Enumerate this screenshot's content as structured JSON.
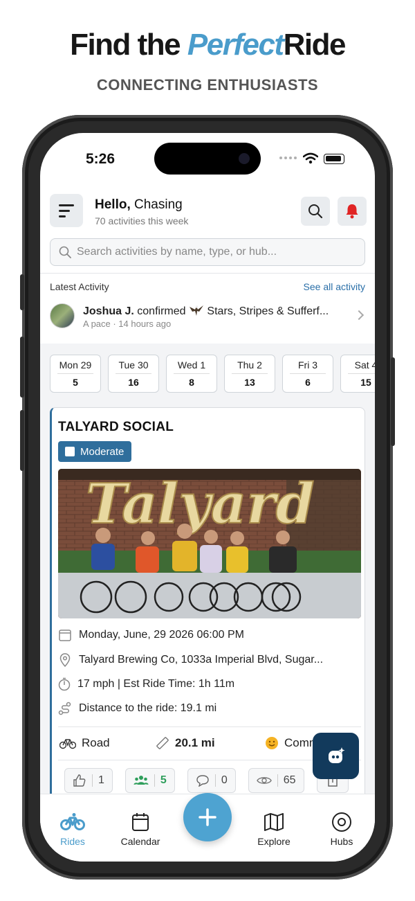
{
  "marketing": {
    "headline_pre": "Find the",
    "headline_accent": "Perfect",
    "headline_post": "Ride",
    "subheadline": "CONNECTING ENTHUSIASTS"
  },
  "status_bar": {
    "time": "5:26"
  },
  "header": {
    "greeting_bold": "Hello,",
    "greeting_name": "Chasing",
    "subtitle": "70 activities this week",
    "search_placeholder": "Search activities by name, type, or hub..."
  },
  "latest_activity": {
    "label": "Latest Activity",
    "see_all": "See all activity",
    "user": "Joshua J.",
    "action": "confirmed",
    "event": "Stars, Stripes & Sufferf...",
    "meta": "A pace · 14 hours ago"
  },
  "days": [
    {
      "label": "Mon 29",
      "count": "5"
    },
    {
      "label": "Tue 30",
      "count": "16"
    },
    {
      "label": "Wed 1",
      "count": "8"
    },
    {
      "label": "Thu 2",
      "count": "13"
    },
    {
      "label": "Fri 3",
      "count": "6"
    },
    {
      "label": "Sat 4",
      "count": "15"
    }
  ],
  "ride_card": {
    "title": "TALYARD SOCIAL",
    "level": "Moderate",
    "photo_sign": "Talyard",
    "date": "Monday, June, 29 2026 06:00 PM",
    "location": "Talyard Brewing Co, 1033a Imperial Blvd, Sugar...",
    "speed": "17 mph | Est Ride Time: 1h 11m",
    "distance_to": "Distance to the ride: 19.1 mi",
    "ride_type": "Road",
    "ride_distance": "20.1 mi",
    "community": "Comm",
    "likes": "1",
    "attendees": "5",
    "comments": "0",
    "views": "65"
  },
  "tabbar": {
    "rides": "Rides",
    "calendar": "Calendar",
    "explore": "Explore",
    "hubs": "Hubs"
  },
  "colors": {
    "accent": "#4a9ccb",
    "brand_dark": "#2f6e9c",
    "navy": "#123a5c",
    "alert_red": "#e02424",
    "attendee_green": "#2e9e5b"
  }
}
